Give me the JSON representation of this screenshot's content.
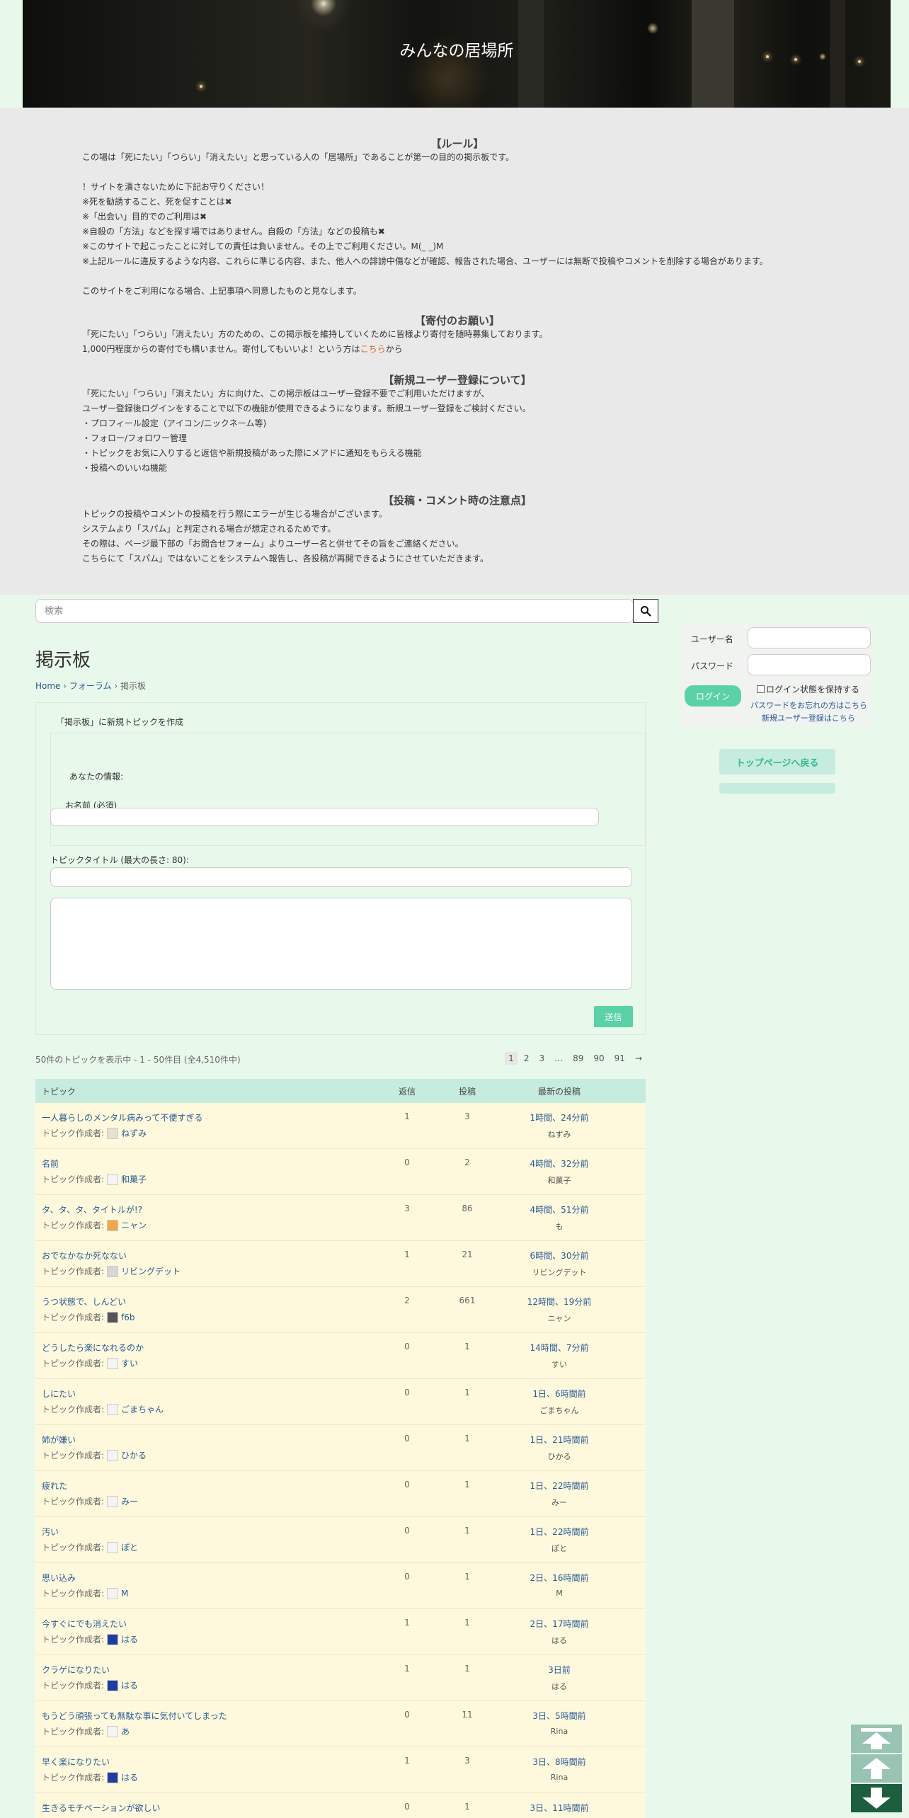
{
  "site": {
    "title": "みんなの居場所"
  },
  "notice": {
    "rules_heading": "【ルール】",
    "rules_lines": [
      "この場は「死にたい」「つらい」「消えたい」と思っている人の「居場所」であることが第一の目的の掲示板です。",
      "",
      "！サイトを潰さないために下記お守りください！",
      "※死を勧誘すること、死を促すことは✖",
      "※「出会い」目的でのご利用は✖",
      "※自殺の「方法」などを探す場ではありません。自殺の「方法」などの投稿も✖",
      "※このサイトで起こったことに対しての責任は負いません。その上でご利用ください。M(_ _)M",
      "※上記ルールに違反するような内容、これらに準じる内容、また、他人への誹謗中傷などが確認、報告された場合、ユーザーには無断で投稿やコメントを削除する場合があります。",
      "",
      "このサイトをご利用になる場合、上記事項へ同意したものと見なします。"
    ],
    "donation_heading": "【寄付のお願い】",
    "donation_line1": "「死にたい」「つらい」「消えたい」方のための、この掲示板を維持していくために皆様より寄付を随時募集しております。",
    "donation_line2_pre": "1,000円程度からの寄付でも構いません。寄付してもいいよ！という方は",
    "donation_link": "こちら",
    "donation_line2_post": "から",
    "register_heading": "【新規ユーザー登録について】",
    "register_lines": [
      "「死にたい」「つらい」「消えたい」方に向けた、この掲示板はユーザー登録不要でご利用いただけますが、",
      "ユーザー登録後ログインをすることで以下の機能が使用できるようになります。新規ユーザー登録をご検討ください。",
      "・プロフィール設定（アイコン/ニックネーム等)",
      "・フォロー/フォロワー管理",
      "・トピックをお気に入りすると返信や新規投稿があった際にメアドに通知をもらえる機能",
      "・投稿へのいいね機能"
    ],
    "post_heading": "【投稿・コメント時の注意点】",
    "post_lines": [
      "トピックの投稿やコメントの投稿を行う際にエラーが生じる場合がございます。",
      "システムより「スパム」と判定される場合が想定されるためです。",
      "その際は、ページ最下部の「お問合せフォーム」よりユーザー名と併せてその旨をご連絡ください。",
      "こちらにて「スパム」ではないことをシステムへ報告し、各投稿が再開できるようにさせていただきます。"
    ]
  },
  "search": {
    "placeholder": "検索"
  },
  "page": {
    "title": "掲示板",
    "breadcrumb_home": "Home",
    "breadcrumb_forum": "フォーラム",
    "breadcrumb_current": "掲示板",
    "separator": "›"
  },
  "form": {
    "legend": "「掲示板」に新規トピックを作成",
    "your_info": "あなたの情報:",
    "name_label": "お名前 (必須)",
    "title_label": "トピックタイトル (最大の長さ: 80):",
    "submit": "送信"
  },
  "listing": {
    "count": "50件のトピックを表示中 - 1 - 50件目 (全4,510件中)",
    "pages": [
      "1",
      "2",
      "3",
      "…",
      "89",
      "90",
      "91",
      "→"
    ]
  },
  "table": {
    "headers": {
      "topic": "トピック",
      "replies": "返信",
      "posts": "投稿",
      "latest": "最新の投稿"
    },
    "author_prefix": "トピック作成者:",
    "rows": [
      {
        "title": "一人暮らしのメンタル病みって不便すぎる",
        "author": "ねずみ",
        "replies": "1",
        "posts": "3",
        "last": "1時間、24分前",
        "last_by": "ねずみ"
      },
      {
        "title": "名前",
        "author": "和菓子",
        "replies": "0",
        "posts": "2",
        "last": "4時間、32分前",
        "last_by": "和菓子"
      },
      {
        "title": "タ、タ、タ、タイトルが!?",
        "author": "ニャン",
        "replies": "3",
        "posts": "86",
        "last": "4時間、51分前",
        "last_by": "も"
      },
      {
        "title": "おでなかなか死なない",
        "author": "リビングデット",
        "replies": "1",
        "posts": "21",
        "last": "6時間、30分前",
        "last_by": "リビングデット"
      },
      {
        "title": "うつ状態で、しんどい",
        "author": "f6b",
        "replies": "2",
        "posts": "661",
        "last": "12時間、19分前",
        "last_by": "ニャン"
      },
      {
        "title": "どうしたら楽になれるのか",
        "author": "すい",
        "replies": "0",
        "posts": "1",
        "last": "14時間、7分前",
        "last_by": "すい"
      },
      {
        "title": "しにたい",
        "author": "ごまちゃん",
        "replies": "0",
        "posts": "1",
        "last": "1日、6時間前",
        "last_by": "ごまちゃん"
      },
      {
        "title": "姉が嫌い",
        "author": "ひかる",
        "replies": "0",
        "posts": "1",
        "last": "1日、21時間前",
        "last_by": "ひかる"
      },
      {
        "title": "疲れた",
        "author": "みー",
        "replies": "0",
        "posts": "1",
        "last": "1日、22時間前",
        "last_by": "みー"
      },
      {
        "title": "汚い",
        "author": "ぽと",
        "replies": "0",
        "posts": "1",
        "last": "1日、22時間前",
        "last_by": "ぽと"
      },
      {
        "title": "思い込み",
        "author": "M",
        "replies": "0",
        "posts": "1",
        "last": "2日、16時間前",
        "last_by": "M"
      },
      {
        "title": "今すぐにでも消えたい",
        "author": "はる",
        "replies": "1",
        "posts": "1",
        "last": "2日、17時間前",
        "last_by": "はる"
      },
      {
        "title": "クラゲになりたい",
        "author": "はる",
        "replies": "1",
        "posts": "1",
        "last": "3日前",
        "last_by": "はる"
      },
      {
        "title": "もうどう頑張っても無駄な事に気付いてしまった",
        "author": "あ",
        "replies": "0",
        "posts": "11",
        "last": "3日、5時間前",
        "last_by": "Rina"
      },
      {
        "title": "早く楽になりたい",
        "author": "はる",
        "replies": "1",
        "posts": "3",
        "last": "3日、8時間前",
        "last_by": "Rina"
      },
      {
        "title": "生きるモチベーションが欲しい",
        "author": "",
        "replies": "0",
        "posts": "1",
        "last": "3日、11時間前",
        "last_by": ""
      }
    ]
  },
  "sidebar": {
    "username_label": "ユーザー名",
    "password_label": "パスワード",
    "login": "ログイン",
    "remember": "ログイン状態を保持する",
    "forgot": "パスワードをお忘れの方はこちら",
    "register": "新規ユーザー登録はこちら",
    "back_to_top": "トップページへ戻る"
  },
  "colors": {
    "accent": "#5bd1a6",
    "header_row": "#c6ece0",
    "row_bg": "#fef9dc",
    "page_bg": "#e8f8ea",
    "link": "#2a5a96"
  },
  "icons": {
    "search": "search-icon",
    "scroll_top": "scroll-top-icon",
    "scroll_up": "scroll-up-icon",
    "scroll_down": "scroll-down-icon"
  }
}
